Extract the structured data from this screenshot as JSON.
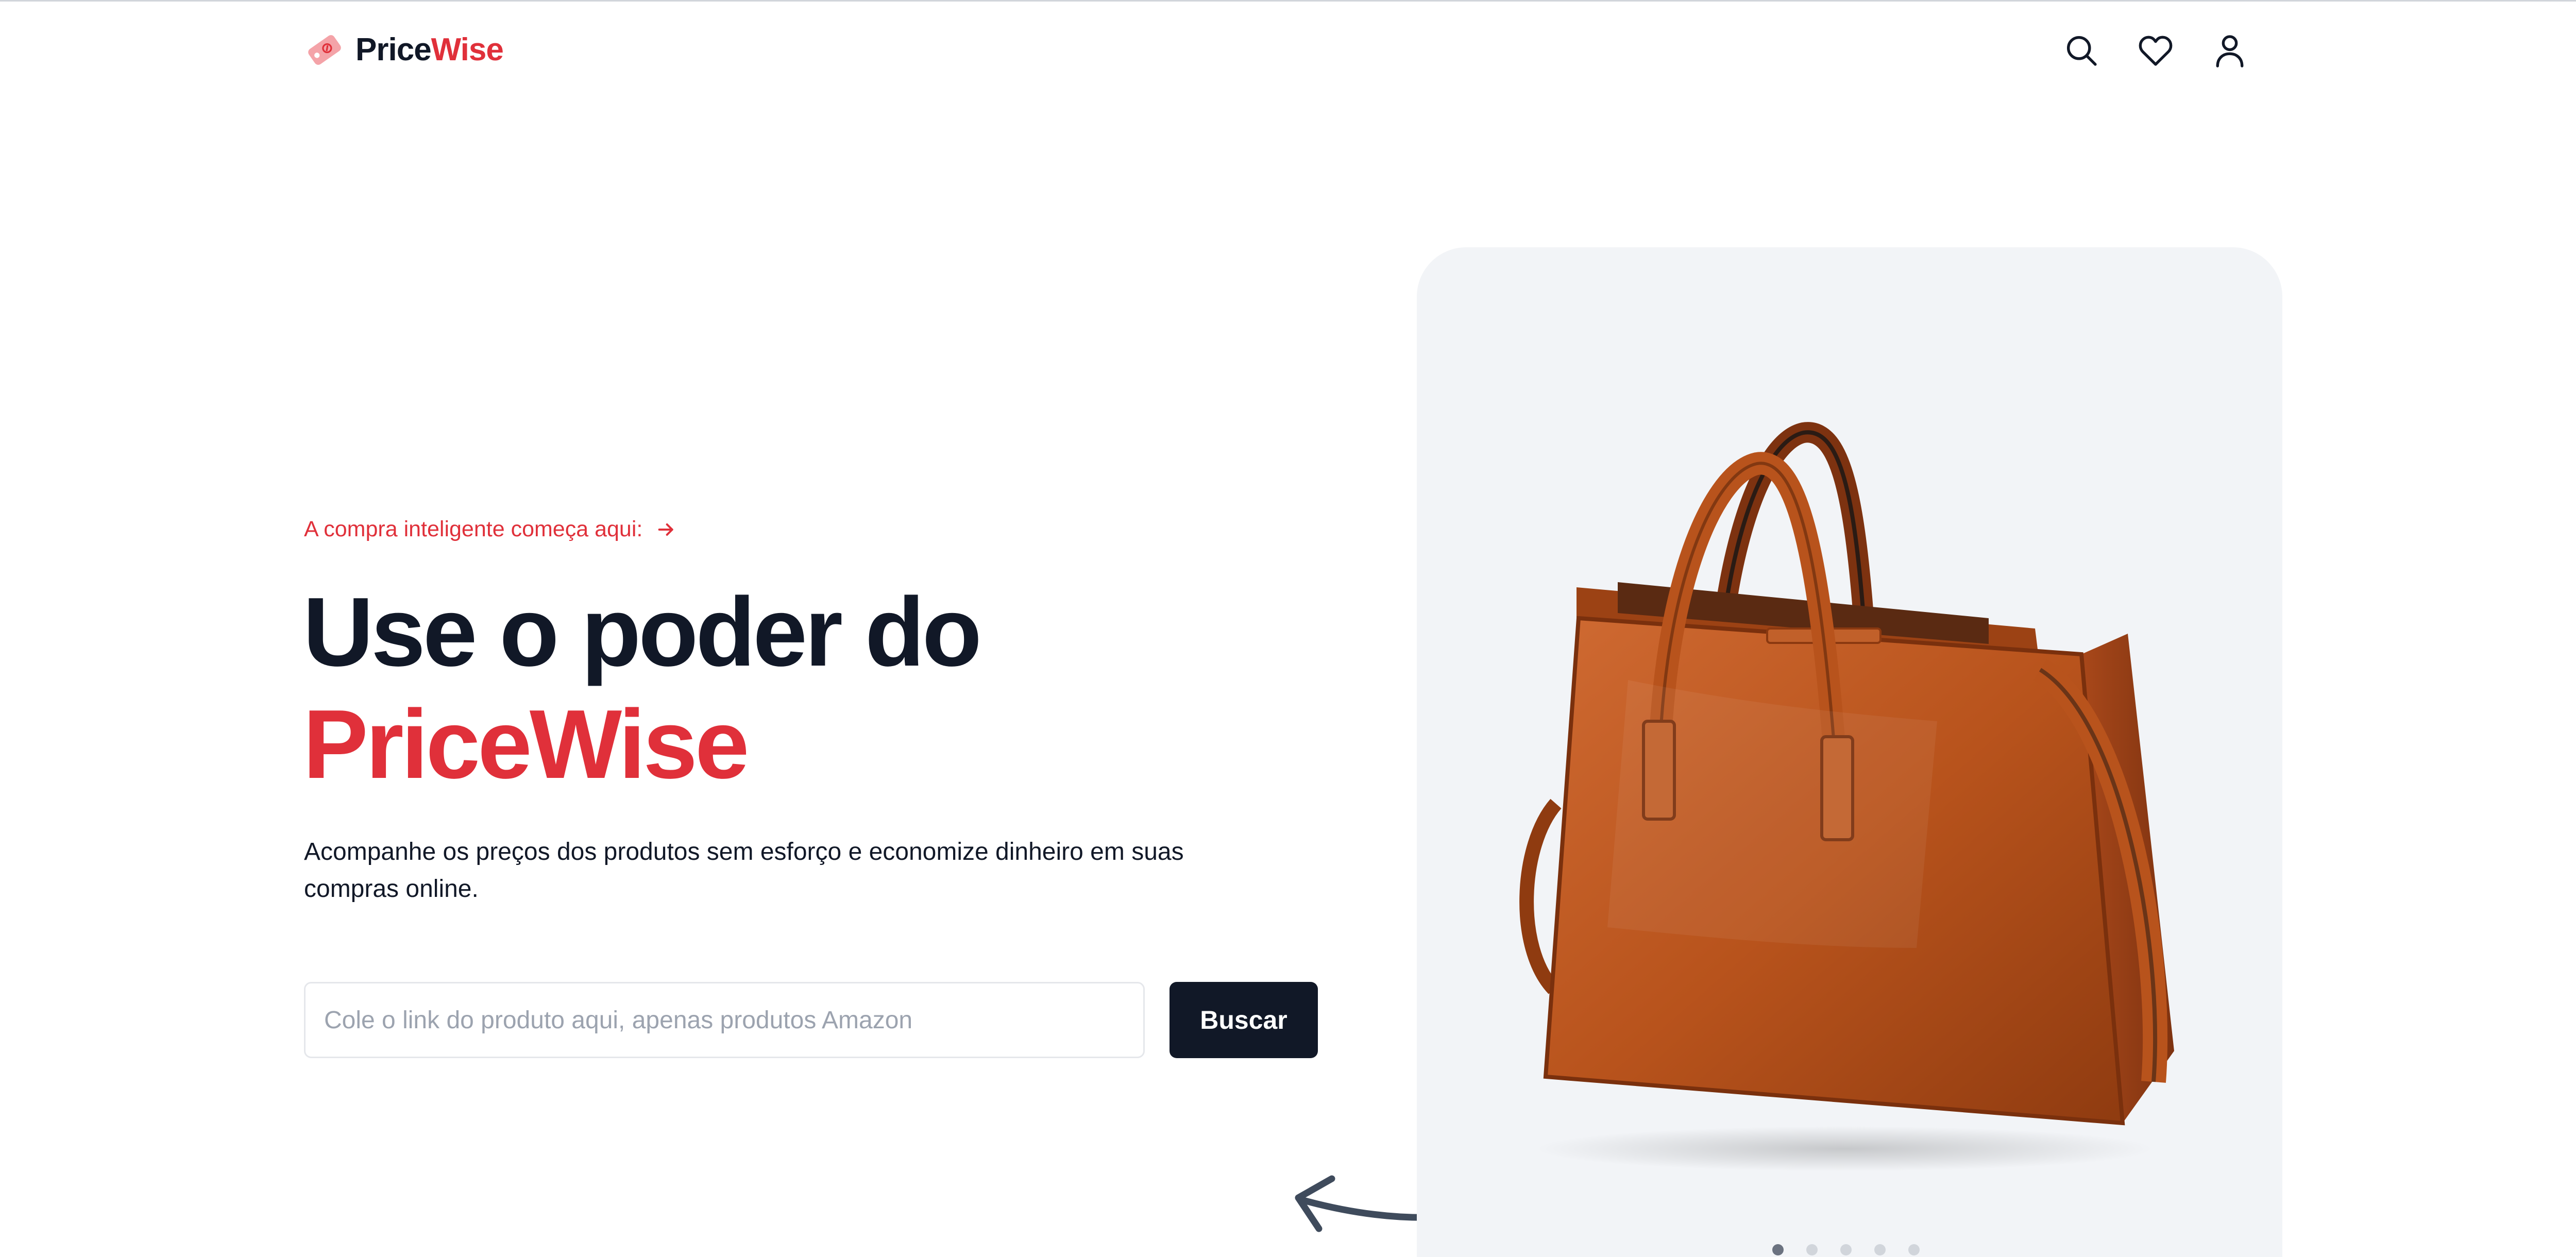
{
  "header": {
    "logo": {
      "name_part1": "Price",
      "name_part2": "Wise",
      "icon": "price-tag-icon"
    },
    "nav_icons": [
      "search-icon",
      "heart-icon",
      "user-icon"
    ]
  },
  "hero": {
    "eyebrow": {
      "text": "A compra inteligente começa aqui:",
      "icon": "arrow-right-icon"
    },
    "headline_line1": "Use o poder do",
    "headline_line2": "PriceWise",
    "subtitle": "Acompanhe os preços dos produtos sem esforço e economize dinheiro em suas compras online.",
    "search": {
      "placeholder": "Cole o link do produto aqui, apenas produtos Amazon",
      "value": "",
      "button_label": "Buscar"
    }
  },
  "carousel": {
    "image": "orange-leather-handbag",
    "slide_count": 5,
    "active_slide": 1
  },
  "colors": {
    "accent": "#e0303a",
    "dark": "#111827",
    "panel_bg": "#f2f4f7",
    "input_border": "#e5e7eb",
    "placeholder": "#9ca3af"
  }
}
